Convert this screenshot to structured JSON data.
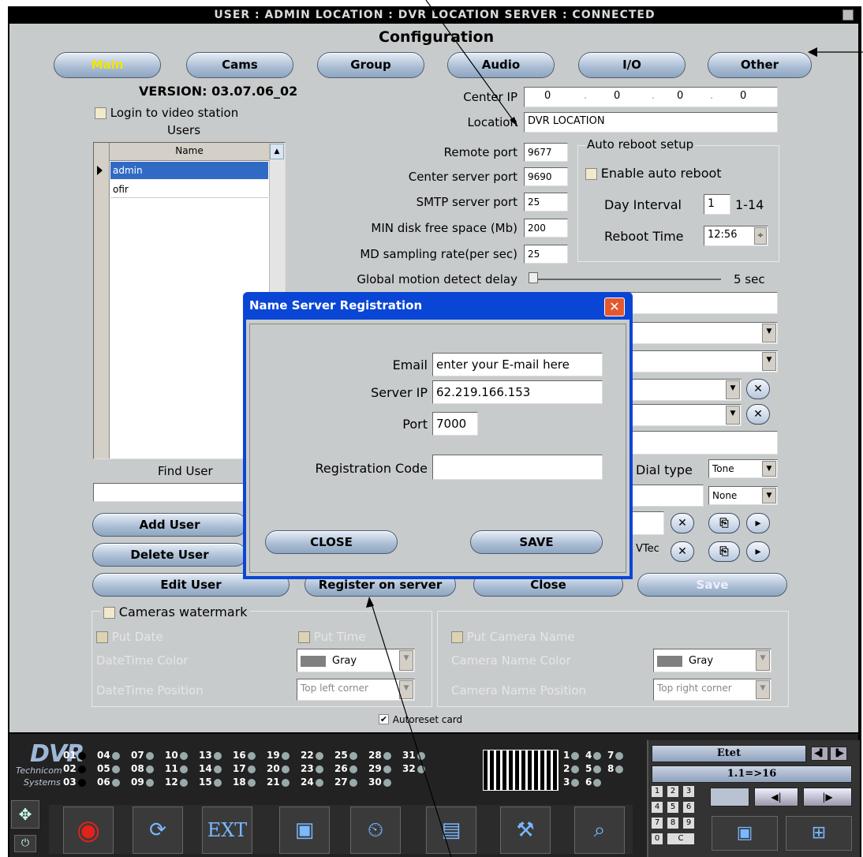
{
  "window": {
    "status": "USER : ADMIN   LOCATION : DVR LOCATION   SERVER : CONNECTED",
    "title": "Configuration"
  },
  "tabs": [
    "Main",
    "Cams",
    "Group",
    "Audio",
    "I/O",
    "Other"
  ],
  "version": "VERSION: 03.07.06_02",
  "login_label": "Login to video station",
  "users": {
    "label": "Users",
    "column": "Name",
    "rows": [
      "admin",
      "ofir"
    ],
    "find_label": "Find User",
    "add": "Add User",
    "delete": "Delete User",
    "edit": "Edit User"
  },
  "fields": {
    "center_ip_label": "Center IP",
    "center_ip": [
      "0",
      "0",
      "0",
      "0"
    ],
    "location_label": "Location",
    "location": "DVR LOCATION",
    "remote_port_label": "Remote port",
    "remote_port": "9677",
    "center_server_port_label": "Center server port",
    "center_server_port": "9690",
    "smtp_port_label": "SMTP server port",
    "smtp_port": "25",
    "min_disk_label": "MIN disk free space (Mb)",
    "min_disk": "200",
    "md_rate_label": "MD sampling rate(per sec)",
    "md_rate": "25",
    "motion_delay_label": "Global motion detect delay",
    "motion_delay": "5 sec"
  },
  "auto_reboot": {
    "legend": "Auto reboot setup",
    "enable": "Enable auto reboot",
    "day_label": "Day Interval",
    "day": "1",
    "range": "1-14",
    "time_label": "Reboot Time",
    "time": "12:56"
  },
  "right_misc": {
    "dial_label": "Dial type",
    "dial": "Tone",
    "none": "None",
    "vtec": "VTec"
  },
  "buttons": {
    "register": "Register on server",
    "close": "Close",
    "save": "Save"
  },
  "watermark": {
    "legend": "Cameras watermark",
    "put_date": "Put Date",
    "put_time": "Put Time",
    "put_camera_name": "Put Camera Name",
    "dt_color_label": "DateTime Color",
    "dt_color": "Gray",
    "dt_pos_label": "DateTime Position",
    "dt_pos": "Top left corner",
    "cam_color_label": "Camera Name Color",
    "cam_color": "Gray",
    "cam_pos_label": "Camera Name Position",
    "cam_pos": "Top right corner",
    "autoreset": "Autoreset card"
  },
  "dialog": {
    "title": "Name Server Registration",
    "email_label": "Email",
    "email": "enter your E-mail here",
    "server_ip_label": "Server IP",
    "server_ip": "62.219.166.153",
    "port_label": "Port",
    "port": "7000",
    "reg_label": "Registration Code",
    "reg": "",
    "close": "CLOSE",
    "save": "SAVE"
  },
  "bottom": {
    "logo": "DVR",
    "company1": "Technicom",
    "company2": "Systems",
    "cams": [
      [
        "01",
        "04",
        "07",
        "10",
        "13",
        "16",
        "19",
        "22",
        "25",
        "28",
        "31"
      ],
      [
        "02",
        "05",
        "08",
        "11",
        "14",
        "17",
        "20",
        "23",
        "26",
        "29",
        "32"
      ],
      [
        "03",
        "06",
        "09",
        "12",
        "15",
        "18",
        "21",
        "24",
        "27",
        "30"
      ]
    ],
    "grid_nums": [
      [
        "1",
        "4",
        "7"
      ],
      [
        "2",
        "5",
        "8"
      ],
      [
        "3",
        "6"
      ]
    ],
    "profile": "Etet",
    "mode": "1.1=>16",
    "keypad": [
      "1",
      "2",
      "3",
      "4",
      "5",
      "6",
      "7",
      "8",
      "9",
      "0",
      "C"
    ],
    "ext": "EXT"
  }
}
